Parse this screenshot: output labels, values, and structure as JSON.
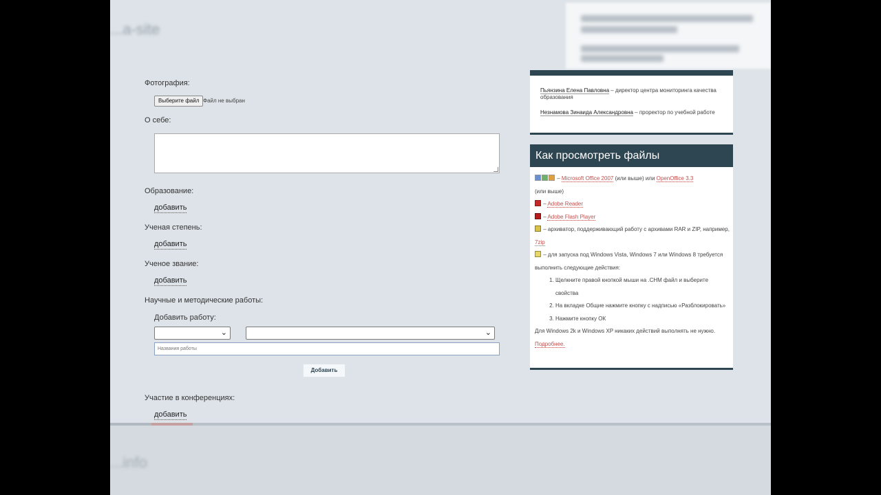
{
  "background": {
    "blur_title": "...a-site",
    "bottom_blur_text": "...info"
  },
  "form": {
    "photo_label": "Фотография:",
    "file_button": "Выберите файл",
    "file_status": "Файл не выбран",
    "about_label": "О себе:",
    "about_value": "",
    "education_label": "Образование:",
    "education_add": "добавить",
    "degree_label": "Ученая степень:",
    "degree_add": "добавить",
    "title_label": "Ученое звание:",
    "title_add": "добавить",
    "works_label": "Научные и методические работы:",
    "add_work_label": "Добавить работу:",
    "work_type_select": "",
    "work_category_select": "",
    "work_name_placeholder": "Названия работы",
    "submit_button": "Добавить",
    "conferences_label": "Участие в конференциях:",
    "conferences_add": "добавить"
  },
  "sidebar": {
    "contacts": [
      {
        "name": "Пьянзина Елена Павловна",
        "role": " – директор центра мониторинга качества образования"
      },
      {
        "name": "Незнамова Зинаида Александровна",
        "role": " – проректор по учебной работе"
      }
    ],
    "files_title": "Как просмотреть файлы",
    "files": {
      "office_link": "Microsoft Office 2007",
      "office_or": " (или выше) или ",
      "openoffice_link": "OpenOffice 3.3",
      "office_tail": "(или выше)",
      "reader_link": "Adobe Reader",
      "flash_link": "Adobe Flash Player",
      "archiver_text": " – архиватор, поддерживающий работу с архивами RAR и ZIP, например, ",
      "zip_link": "7zip",
      "chm_text": " – для запуска под Windows Vista, Windows 7 или Windows 8 требуется выполнить следующие действия:",
      "steps": [
        "Щелкните правой кнопкой мыши на .CHM файл и выберите свойства",
        "На вкладке Общие нажмите кнопку с надписью «Разблокировать»",
        "Нажмите кнопку ОК"
      ],
      "footer_text": "Для Windows 2k и Windows XP никаких действий выполнять не нужно. ",
      "more_link": "Подробнее."
    }
  },
  "colors": {
    "panel_header": "#2e4552",
    "link": "#c0504d",
    "page_bg": "#dde3e8"
  }
}
